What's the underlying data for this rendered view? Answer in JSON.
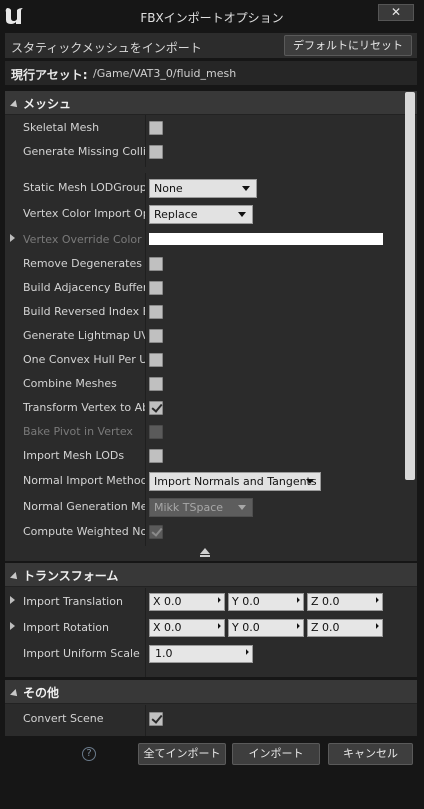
{
  "window": {
    "title": "FBXインポートオプション",
    "close_glyph": "✕"
  },
  "topbar": {
    "text": "スタティックメッシュをインポート",
    "reset_label": "デフォルトにリセット"
  },
  "asset": {
    "label": "現行アセット:",
    "path": "/Game/VAT3_0/fluid_mesh"
  },
  "sections": {
    "mesh": {
      "title": "メッシュ"
    },
    "transform": {
      "title": "トランスフォーム"
    },
    "misc": {
      "title": "その他"
    }
  },
  "mesh_rows": [
    {
      "label": "Skeletal Mesh",
      "type": "checkbox",
      "checked": false
    },
    {
      "label": "Generate Missing Collisi",
      "type": "checkbox",
      "checked": false
    },
    {
      "label": "Static Mesh LODGroup",
      "type": "combo",
      "value": "None"
    },
    {
      "label": "Vertex Color Import Opti",
      "type": "combo",
      "value": "Replace"
    },
    {
      "label": "Vertex Override Color",
      "type": "color",
      "value": "#FFFFFF",
      "dim": true
    },
    {
      "label": "Remove Degenerates",
      "type": "checkbox",
      "checked": false
    },
    {
      "label": "Build Adjacency Buffer",
      "type": "checkbox",
      "checked": false
    },
    {
      "label": "Build Reversed Index Bu",
      "type": "checkbox",
      "checked": false
    },
    {
      "label": "Generate Lightmap UVs",
      "type": "checkbox",
      "checked": false
    },
    {
      "label": "One Convex Hull Per UC>",
      "type": "checkbox",
      "checked": false
    },
    {
      "label": "Combine Meshes",
      "type": "checkbox",
      "checked": false
    },
    {
      "label": "Transform Vertex to Abs",
      "type": "checkbox",
      "checked": true
    },
    {
      "label": "Bake Pivot in Vertex",
      "type": "checkbox",
      "checked": false,
      "dim": true
    },
    {
      "label": "Import Mesh LODs",
      "type": "checkbox",
      "checked": false
    },
    {
      "label": "Normal Import Method",
      "type": "combo",
      "value": "Import Normals and Tangents"
    },
    {
      "label": "Normal Generation Meth",
      "type": "combo",
      "value": "Mikk TSpace",
      "dim": true
    },
    {
      "label": "Compute Weighted Norm",
      "type": "checkbox",
      "checked": true,
      "dim_box": true
    }
  ],
  "transform_rows": [
    {
      "label": "Import Translation",
      "x": "X  0.0",
      "y": "Y  0.0",
      "z": "Z  0.0"
    },
    {
      "label": "Import Rotation",
      "x": "X  0.0",
      "y": "Y  0.0",
      "z": "Z  0.0"
    },
    {
      "label": "Import Uniform Scale",
      "value": "1.0"
    }
  ],
  "misc_rows": [
    {
      "label": "Convert Scene",
      "checked": true
    }
  ],
  "footer": {
    "help_glyph": "?",
    "import_all_label": "全てインポート",
    "import_label": "インポート",
    "cancel_label": "キャンセル"
  },
  "colors": {
    "accent": "#e2e2e2",
    "panel": "#2b2b2b",
    "header": "#383838"
  }
}
